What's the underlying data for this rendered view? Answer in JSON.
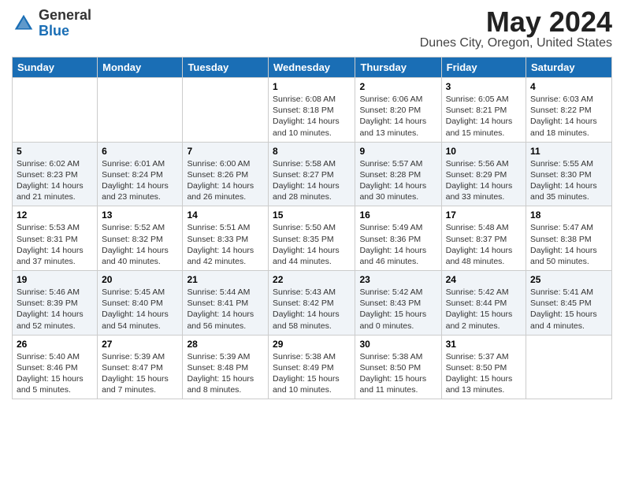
{
  "logo": {
    "general": "General",
    "blue": "Blue"
  },
  "title": "May 2024",
  "location": "Dunes City, Oregon, United States",
  "weekdays": [
    "Sunday",
    "Monday",
    "Tuesday",
    "Wednesday",
    "Thursday",
    "Friday",
    "Saturday"
  ],
  "weeks": [
    [
      {
        "day": "",
        "info": ""
      },
      {
        "day": "",
        "info": ""
      },
      {
        "day": "",
        "info": ""
      },
      {
        "day": "1",
        "info": "Sunrise: 6:08 AM\nSunset: 8:18 PM\nDaylight: 14 hours\nand 10 minutes."
      },
      {
        "day": "2",
        "info": "Sunrise: 6:06 AM\nSunset: 8:20 PM\nDaylight: 14 hours\nand 13 minutes."
      },
      {
        "day": "3",
        "info": "Sunrise: 6:05 AM\nSunset: 8:21 PM\nDaylight: 14 hours\nand 15 minutes."
      },
      {
        "day": "4",
        "info": "Sunrise: 6:03 AM\nSunset: 8:22 PM\nDaylight: 14 hours\nand 18 minutes."
      }
    ],
    [
      {
        "day": "5",
        "info": "Sunrise: 6:02 AM\nSunset: 8:23 PM\nDaylight: 14 hours\nand 21 minutes."
      },
      {
        "day": "6",
        "info": "Sunrise: 6:01 AM\nSunset: 8:24 PM\nDaylight: 14 hours\nand 23 minutes."
      },
      {
        "day": "7",
        "info": "Sunrise: 6:00 AM\nSunset: 8:26 PM\nDaylight: 14 hours\nand 26 minutes."
      },
      {
        "day": "8",
        "info": "Sunrise: 5:58 AM\nSunset: 8:27 PM\nDaylight: 14 hours\nand 28 minutes."
      },
      {
        "day": "9",
        "info": "Sunrise: 5:57 AM\nSunset: 8:28 PM\nDaylight: 14 hours\nand 30 minutes."
      },
      {
        "day": "10",
        "info": "Sunrise: 5:56 AM\nSunset: 8:29 PM\nDaylight: 14 hours\nand 33 minutes."
      },
      {
        "day": "11",
        "info": "Sunrise: 5:55 AM\nSunset: 8:30 PM\nDaylight: 14 hours\nand 35 minutes."
      }
    ],
    [
      {
        "day": "12",
        "info": "Sunrise: 5:53 AM\nSunset: 8:31 PM\nDaylight: 14 hours\nand 37 minutes."
      },
      {
        "day": "13",
        "info": "Sunrise: 5:52 AM\nSunset: 8:32 PM\nDaylight: 14 hours\nand 40 minutes."
      },
      {
        "day": "14",
        "info": "Sunrise: 5:51 AM\nSunset: 8:33 PM\nDaylight: 14 hours\nand 42 minutes."
      },
      {
        "day": "15",
        "info": "Sunrise: 5:50 AM\nSunset: 8:35 PM\nDaylight: 14 hours\nand 44 minutes."
      },
      {
        "day": "16",
        "info": "Sunrise: 5:49 AM\nSunset: 8:36 PM\nDaylight: 14 hours\nand 46 minutes."
      },
      {
        "day": "17",
        "info": "Sunrise: 5:48 AM\nSunset: 8:37 PM\nDaylight: 14 hours\nand 48 minutes."
      },
      {
        "day": "18",
        "info": "Sunrise: 5:47 AM\nSunset: 8:38 PM\nDaylight: 14 hours\nand 50 minutes."
      }
    ],
    [
      {
        "day": "19",
        "info": "Sunrise: 5:46 AM\nSunset: 8:39 PM\nDaylight: 14 hours\nand 52 minutes."
      },
      {
        "day": "20",
        "info": "Sunrise: 5:45 AM\nSunset: 8:40 PM\nDaylight: 14 hours\nand 54 minutes."
      },
      {
        "day": "21",
        "info": "Sunrise: 5:44 AM\nSunset: 8:41 PM\nDaylight: 14 hours\nand 56 minutes."
      },
      {
        "day": "22",
        "info": "Sunrise: 5:43 AM\nSunset: 8:42 PM\nDaylight: 14 hours\nand 58 minutes."
      },
      {
        "day": "23",
        "info": "Sunrise: 5:42 AM\nSunset: 8:43 PM\nDaylight: 15 hours\nand 0 minutes."
      },
      {
        "day": "24",
        "info": "Sunrise: 5:42 AM\nSunset: 8:44 PM\nDaylight: 15 hours\nand 2 minutes."
      },
      {
        "day": "25",
        "info": "Sunrise: 5:41 AM\nSunset: 8:45 PM\nDaylight: 15 hours\nand 4 minutes."
      }
    ],
    [
      {
        "day": "26",
        "info": "Sunrise: 5:40 AM\nSunset: 8:46 PM\nDaylight: 15 hours\nand 5 minutes."
      },
      {
        "day": "27",
        "info": "Sunrise: 5:39 AM\nSunset: 8:47 PM\nDaylight: 15 hours\nand 7 minutes."
      },
      {
        "day": "28",
        "info": "Sunrise: 5:39 AM\nSunset: 8:48 PM\nDaylight: 15 hours\nand 8 minutes."
      },
      {
        "day": "29",
        "info": "Sunrise: 5:38 AM\nSunset: 8:49 PM\nDaylight: 15 hours\nand 10 minutes."
      },
      {
        "day": "30",
        "info": "Sunrise: 5:38 AM\nSunset: 8:50 PM\nDaylight: 15 hours\nand 11 minutes."
      },
      {
        "day": "31",
        "info": "Sunrise: 5:37 AM\nSunset: 8:50 PM\nDaylight: 15 hours\nand 13 minutes."
      },
      {
        "day": "",
        "info": ""
      }
    ]
  ]
}
